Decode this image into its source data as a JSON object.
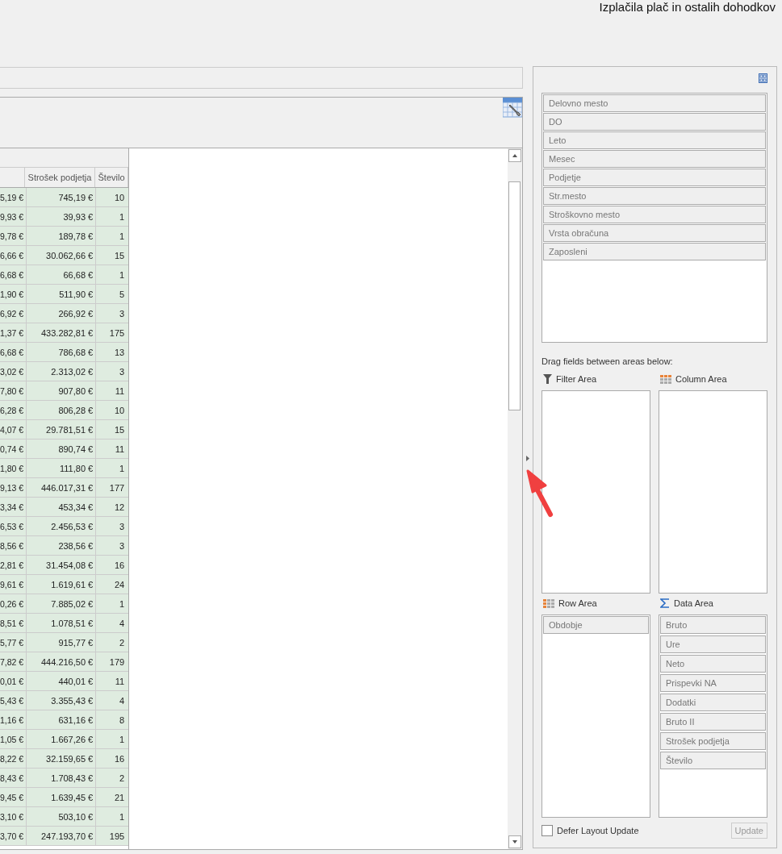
{
  "header": {
    "title": "Izplačila plač in ostalih dohodkov"
  },
  "table": {
    "columns": [
      "Strošek podjetja",
      "Število"
    ],
    "rows": [
      {
        "column_1": "5,19 €",
        "cost": "745,19 €",
        "count": "10"
      },
      {
        "column_1": "9,93 €",
        "cost": "39,93 €",
        "count": "1"
      },
      {
        "column_1": "9,78 €",
        "cost": "189,78 €",
        "count": "1"
      },
      {
        "column_1": "6,66 €",
        "cost": "30.062,66 €",
        "count": "15"
      },
      {
        "column_1": "6,68 €",
        "cost": "66,68 €",
        "count": "1"
      },
      {
        "column_1": "1,90 €",
        "cost": "511,90 €",
        "count": "5"
      },
      {
        "column_1": "6,92 €",
        "cost": "266,92 €",
        "count": "3"
      },
      {
        "column_1": "1,37 €",
        "cost": "433.282,81 €",
        "count": "175"
      },
      {
        "column_1": "6,68 €",
        "cost": "786,68 €",
        "count": "13"
      },
      {
        "column_1": "3,02 €",
        "cost": "2.313,02 €",
        "count": "3"
      },
      {
        "column_1": "7,80 €",
        "cost": "907,80 €",
        "count": "11"
      },
      {
        "column_1": "6,28 €",
        "cost": "806,28 €",
        "count": "10"
      },
      {
        "column_1": "4,07 €",
        "cost": "29.781,51 €",
        "count": "15"
      },
      {
        "column_1": "0,74 €",
        "cost": "890,74 €",
        "count": "11"
      },
      {
        "column_1": "1,80 €",
        "cost": "111,80 €",
        "count": "1"
      },
      {
        "column_1": "9,13 €",
        "cost": "446.017,31 €",
        "count": "177"
      },
      {
        "column_1": "3,34 €",
        "cost": "453,34 €",
        "count": "12"
      },
      {
        "column_1": "6,53 €",
        "cost": "2.456,53 €",
        "count": "3"
      },
      {
        "column_1": "8,56 €",
        "cost": "238,56 €",
        "count": "3"
      },
      {
        "column_1": "2,81 €",
        "cost": "31.454,08 €",
        "count": "16"
      },
      {
        "column_1": "9,61 €",
        "cost": "1.619,61 €",
        "count": "24"
      },
      {
        "column_1": "0,26 €",
        "cost": "7.885,02 €",
        "count": "1"
      },
      {
        "column_1": "8,51 €",
        "cost": "1.078,51 €",
        "count": "4"
      },
      {
        "column_1": "5,77 €",
        "cost": "915,77 €",
        "count": "2"
      },
      {
        "column_1": "7,82 €",
        "cost": "444.216,50 €",
        "count": "179"
      },
      {
        "column_1": "0,01 €",
        "cost": "440,01 €",
        "count": "11"
      },
      {
        "column_1": "5,43 €",
        "cost": "3.355,43 €",
        "count": "4"
      },
      {
        "column_1": "1,16 €",
        "cost": "631,16 €",
        "count": "8"
      },
      {
        "column_1": "1,05 €",
        "cost": "1.667,26 €",
        "count": "1"
      },
      {
        "column_1": "8,22 €",
        "cost": "32.159,65 €",
        "count": "16"
      },
      {
        "column_1": "8,43 €",
        "cost": "1.708,43 €",
        "count": "2"
      },
      {
        "column_1": "9,45 €",
        "cost": "1.639,45 €",
        "count": "21"
      },
      {
        "column_1": "3,10 €",
        "cost": "503,10 €",
        "count": "1"
      },
      {
        "column_1": "3,70 €",
        "cost": "247.193,70 €",
        "count": "195"
      }
    ]
  },
  "field_list": {
    "fields": [
      "Delovno mesto",
      "DO",
      "Leto",
      "Mesec",
      "Podjetje",
      "Str.mesto",
      "Stroškovno mesto",
      "Vrsta obračuna",
      "Zaposleni"
    ],
    "hint": "Drag fields between areas below:",
    "areas": [
      {
        "kind": "filter",
        "label": "Filter Area"
      },
      {
        "kind": "column",
        "label": "Column Area"
      },
      {
        "kind": "row",
        "label": "Row Area",
        "fields": [
          "Obdobje"
        ]
      },
      {
        "kind": "data",
        "label": "Data Area",
        "fields": [
          "Bruto",
          "Ure",
          "Neto",
          "Prispevki NA",
          "Dodatki",
          "Bruto II",
          "Strošek podjetja",
          "Število"
        ]
      }
    ],
    "defer_layout_update": {
      "label": "Defer Layout Update",
      "checked": false
    },
    "update_button": {
      "label": "Update",
      "disabled": true
    }
  }
}
